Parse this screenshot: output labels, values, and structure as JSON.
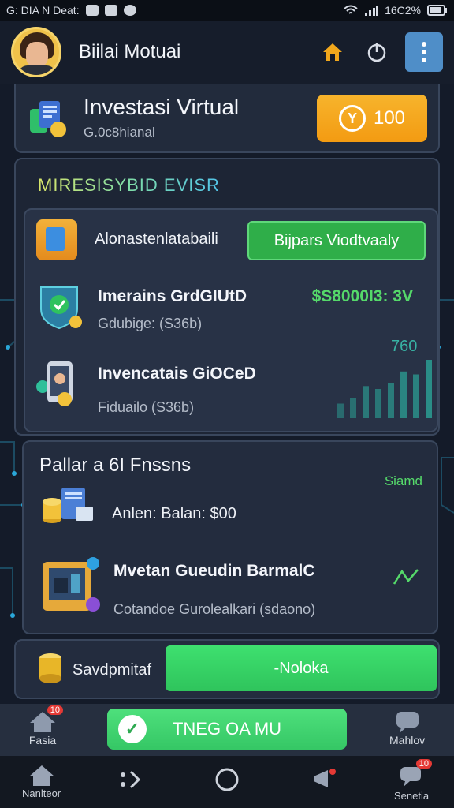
{
  "status_bar": {
    "left_text": "G: DIA N Deat:",
    "right_text": "16C2%"
  },
  "header": {
    "title": "Biilai Motuai",
    "home_icon": "home-icon",
    "power_icon": "power-icon",
    "menu_icon": "more-vertical-icon"
  },
  "top_card": {
    "title": "Investasi Virtual",
    "subtitle": "G.0c8hianal",
    "coin_value": "100",
    "coin_symbol": "Y"
  },
  "main_card": {
    "heading": "MIRESISYBID EVISR",
    "section_label": "Alonastenlatabaili",
    "action_button": "Bijpars Viodtvaaly",
    "items": [
      {
        "title": "Imerains GrdGIUtD",
        "subtitle": "Gdubige: (S36b)",
        "value": "$S8000I3: 3V"
      },
      {
        "title": "Invencatais GiOCeD",
        "subtitle": "Fiduailo (S36b)",
        "value": ""
      }
    ],
    "chart_label": "760",
    "chart_bars": [
      0.25,
      0.35,
      0.55,
      0.5,
      0.6,
      0.8,
      0.75,
      1.0
    ],
    "colors": {
      "value_green": "#55d96a",
      "bar": "#2a8d87"
    }
  },
  "pallet_card": {
    "title": "Pallar a 6I Fnssns",
    "badge": "Siamd",
    "balance": "Anlen: Balan: $00",
    "item_title": "Mvetan Gueudin BarmalC",
    "item_subtitle": "Cotandoe Gurolealkari (sdaono)"
  },
  "bottom_card": {
    "label": "Savdpmitaf",
    "button": "-Noloka"
  },
  "app_bar": {
    "left_label": "Fasia",
    "left_badge": "10",
    "cta": "TNEG OA MU",
    "right_label": "Mahlov"
  },
  "nav_bar": {
    "home_label": "Nanlteor",
    "right_label": "Senetia",
    "right_badge": "10"
  }
}
